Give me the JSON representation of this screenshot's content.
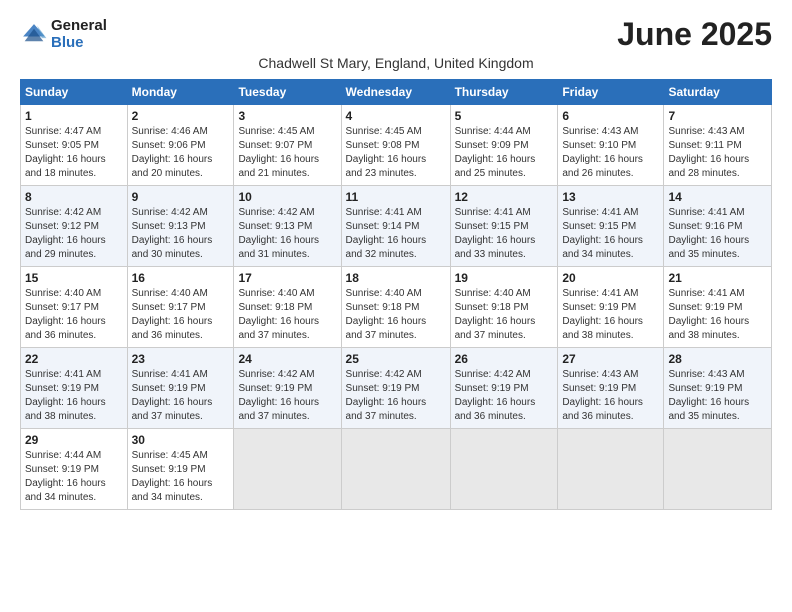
{
  "header": {
    "logo_general": "General",
    "logo_blue": "Blue",
    "month_title": "June 2025",
    "subtitle": "Chadwell St Mary, England, United Kingdom"
  },
  "days_of_week": [
    "Sunday",
    "Monday",
    "Tuesday",
    "Wednesday",
    "Thursday",
    "Friday",
    "Saturday"
  ],
  "weeks": [
    [
      {
        "day": "1",
        "info": "Sunrise: 4:47 AM\nSunset: 9:05 PM\nDaylight: 16 hours and 18 minutes."
      },
      {
        "day": "2",
        "info": "Sunrise: 4:46 AM\nSunset: 9:06 PM\nDaylight: 16 hours and 20 minutes."
      },
      {
        "day": "3",
        "info": "Sunrise: 4:45 AM\nSunset: 9:07 PM\nDaylight: 16 hours and 21 minutes."
      },
      {
        "day": "4",
        "info": "Sunrise: 4:45 AM\nSunset: 9:08 PM\nDaylight: 16 hours and 23 minutes."
      },
      {
        "day": "5",
        "info": "Sunrise: 4:44 AM\nSunset: 9:09 PM\nDaylight: 16 hours and 25 minutes."
      },
      {
        "day": "6",
        "info": "Sunrise: 4:43 AM\nSunset: 9:10 PM\nDaylight: 16 hours and 26 minutes."
      },
      {
        "day": "7",
        "info": "Sunrise: 4:43 AM\nSunset: 9:11 PM\nDaylight: 16 hours and 28 minutes."
      }
    ],
    [
      {
        "day": "8",
        "info": "Sunrise: 4:42 AM\nSunset: 9:12 PM\nDaylight: 16 hours and 29 minutes."
      },
      {
        "day": "9",
        "info": "Sunrise: 4:42 AM\nSunset: 9:13 PM\nDaylight: 16 hours and 30 minutes."
      },
      {
        "day": "10",
        "info": "Sunrise: 4:42 AM\nSunset: 9:13 PM\nDaylight: 16 hours and 31 minutes."
      },
      {
        "day": "11",
        "info": "Sunrise: 4:41 AM\nSunset: 9:14 PM\nDaylight: 16 hours and 32 minutes."
      },
      {
        "day": "12",
        "info": "Sunrise: 4:41 AM\nSunset: 9:15 PM\nDaylight: 16 hours and 33 minutes."
      },
      {
        "day": "13",
        "info": "Sunrise: 4:41 AM\nSunset: 9:15 PM\nDaylight: 16 hours and 34 minutes."
      },
      {
        "day": "14",
        "info": "Sunrise: 4:41 AM\nSunset: 9:16 PM\nDaylight: 16 hours and 35 minutes."
      }
    ],
    [
      {
        "day": "15",
        "info": "Sunrise: 4:40 AM\nSunset: 9:17 PM\nDaylight: 16 hours and 36 minutes."
      },
      {
        "day": "16",
        "info": "Sunrise: 4:40 AM\nSunset: 9:17 PM\nDaylight: 16 hours and 36 minutes."
      },
      {
        "day": "17",
        "info": "Sunrise: 4:40 AM\nSunset: 9:18 PM\nDaylight: 16 hours and 37 minutes."
      },
      {
        "day": "18",
        "info": "Sunrise: 4:40 AM\nSunset: 9:18 PM\nDaylight: 16 hours and 37 minutes."
      },
      {
        "day": "19",
        "info": "Sunrise: 4:40 AM\nSunset: 9:18 PM\nDaylight: 16 hours and 37 minutes."
      },
      {
        "day": "20",
        "info": "Sunrise: 4:41 AM\nSunset: 9:19 PM\nDaylight: 16 hours and 38 minutes."
      },
      {
        "day": "21",
        "info": "Sunrise: 4:41 AM\nSunset: 9:19 PM\nDaylight: 16 hours and 38 minutes."
      }
    ],
    [
      {
        "day": "22",
        "info": "Sunrise: 4:41 AM\nSunset: 9:19 PM\nDaylight: 16 hours and 38 minutes."
      },
      {
        "day": "23",
        "info": "Sunrise: 4:41 AM\nSunset: 9:19 PM\nDaylight: 16 hours and 37 minutes."
      },
      {
        "day": "24",
        "info": "Sunrise: 4:42 AM\nSunset: 9:19 PM\nDaylight: 16 hours and 37 minutes."
      },
      {
        "day": "25",
        "info": "Sunrise: 4:42 AM\nSunset: 9:19 PM\nDaylight: 16 hours and 37 minutes."
      },
      {
        "day": "26",
        "info": "Sunrise: 4:42 AM\nSunset: 9:19 PM\nDaylight: 16 hours and 36 minutes."
      },
      {
        "day": "27",
        "info": "Sunrise: 4:43 AM\nSunset: 9:19 PM\nDaylight: 16 hours and 36 minutes."
      },
      {
        "day": "28",
        "info": "Sunrise: 4:43 AM\nSunset: 9:19 PM\nDaylight: 16 hours and 35 minutes."
      }
    ],
    [
      {
        "day": "29",
        "info": "Sunrise: 4:44 AM\nSunset: 9:19 PM\nDaylight: 16 hours and 34 minutes."
      },
      {
        "day": "30",
        "info": "Sunrise: 4:45 AM\nSunset: 9:19 PM\nDaylight: 16 hours and 34 minutes."
      },
      {
        "day": "",
        "info": ""
      },
      {
        "day": "",
        "info": ""
      },
      {
        "day": "",
        "info": ""
      },
      {
        "day": "",
        "info": ""
      },
      {
        "day": "",
        "info": ""
      }
    ]
  ]
}
